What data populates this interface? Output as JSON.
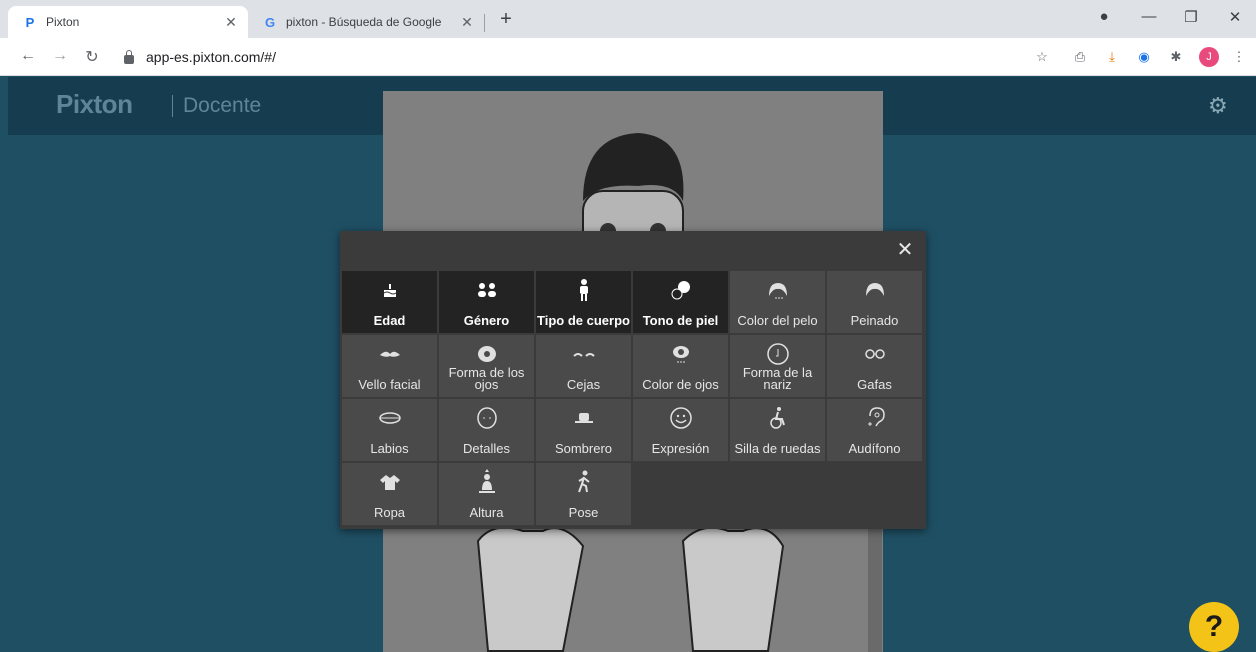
{
  "browser": {
    "tabs": [
      {
        "title": "Pixton",
        "active": true
      },
      {
        "title": "pixton - Búsqueda de Google",
        "active": false
      }
    ],
    "url": "app-es.pixton.com/#/",
    "profile_initial": "J"
  },
  "header": {
    "logo": "Pixton",
    "subtitle": "Docente"
  },
  "modal": {
    "items": [
      {
        "label": "Edad",
        "icon": "cake-icon",
        "selected": true
      },
      {
        "label": "Género",
        "icon": "people-icon",
        "selected": true
      },
      {
        "label": "Tipo de cuerpo",
        "icon": "body-icon",
        "selected": true
      },
      {
        "label": "Tono de piel",
        "icon": "skin-tone-icon",
        "selected": true
      },
      {
        "label": "Color del pelo",
        "icon": "hair-color-icon",
        "selected": false
      },
      {
        "label": "Peinado",
        "icon": "hairstyle-icon",
        "selected": false
      },
      {
        "label": "Vello facial",
        "icon": "mustache-icon",
        "selected": false
      },
      {
        "label": "Forma de los ojos",
        "icon": "eye-shape-icon",
        "selected": false
      },
      {
        "label": "Cejas",
        "icon": "eyebrows-icon",
        "selected": false
      },
      {
        "label": "Color de ojos",
        "icon": "eye-color-icon",
        "selected": false
      },
      {
        "label": "Forma de la nariz",
        "icon": "nose-icon",
        "selected": false
      },
      {
        "label": "Gafas",
        "icon": "glasses-icon",
        "selected": false
      },
      {
        "label": "Labios",
        "icon": "lips-icon",
        "selected": false
      },
      {
        "label": "Detalles",
        "icon": "face-details-icon",
        "selected": false
      },
      {
        "label": "Sombrero",
        "icon": "hat-icon",
        "selected": false
      },
      {
        "label": "Expresión",
        "icon": "smile-icon",
        "selected": false
      },
      {
        "label": "Silla de ruedas",
        "icon": "wheelchair-icon",
        "selected": false
      },
      {
        "label": "Audífono",
        "icon": "hearing-aid-icon",
        "selected": false
      },
      {
        "label": "Ropa",
        "icon": "shirt-icon",
        "selected": false
      },
      {
        "label": "Altura",
        "icon": "height-icon",
        "selected": false
      },
      {
        "label": "Pose",
        "icon": "pose-icon",
        "selected": false
      }
    ]
  },
  "help_label": "?"
}
